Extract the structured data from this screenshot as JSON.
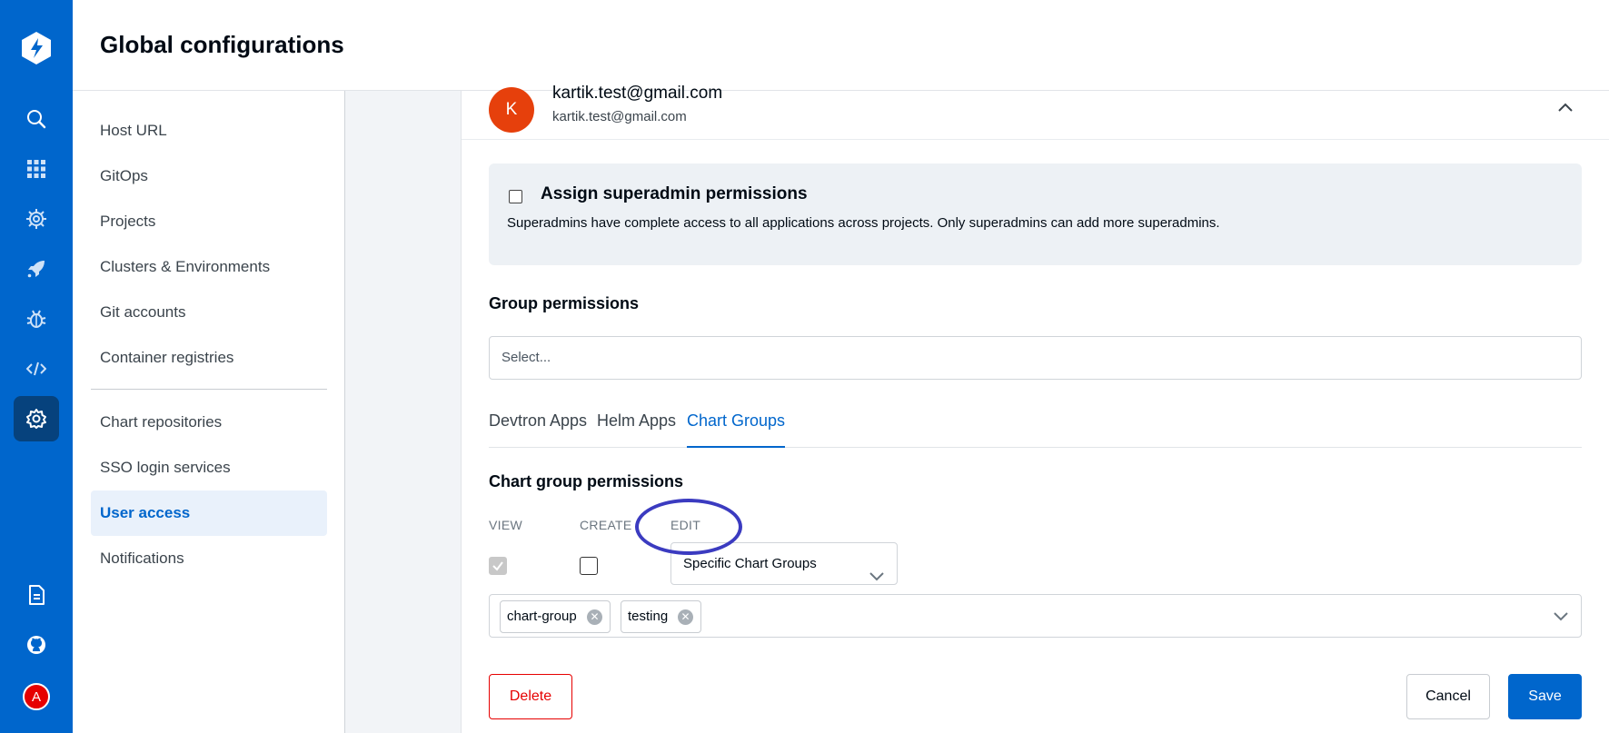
{
  "app": {
    "title": "Global configurations"
  },
  "rail": {
    "icons": [
      "devtron-logo-icon",
      "search-icon",
      "apps-grid-icon",
      "helm-chart-icon",
      "deploy-rocket-icon",
      "security-bug-icon",
      "code-icon",
      "settings-gear-icon",
      "docs-icon",
      "github-icon"
    ],
    "avatar_letter": "A",
    "colors": {
      "rail": "#0066cc",
      "active": "#06427d"
    }
  },
  "sidebar": {
    "items": [
      {
        "label": "Host URL"
      },
      {
        "label": "GitOps"
      },
      {
        "label": "Projects"
      },
      {
        "label": "Clusters & Environments"
      },
      {
        "label": "Git accounts"
      },
      {
        "label": "Container registries"
      },
      {
        "label": "Chart repositories"
      },
      {
        "label": "SSO login services"
      },
      {
        "label": "User access"
      },
      {
        "label": "Notifications"
      }
    ],
    "active": "User access"
  },
  "user": {
    "avatar_letter": "K",
    "name": "kartik.test@gmail.com",
    "email": "kartik.test@gmail.com"
  },
  "superadmin": {
    "title": "Assign superadmin permissions",
    "description": "Superadmins have complete access to all applications across projects. Only superadmins can add more superadmins.",
    "checked": false
  },
  "group_permissions": {
    "title": "Group permissions",
    "placeholder": "Select..."
  },
  "tabs": [
    {
      "label": "Devtron Apps"
    },
    {
      "label": "Helm Apps"
    },
    {
      "label": "Chart Groups"
    }
  ],
  "active_tab": "Chart Groups",
  "chart_group_permissions": {
    "title": "Chart group permissions",
    "columns": {
      "view": "VIEW",
      "create": "CREATE",
      "edit": "EDIT"
    },
    "view_checked": true,
    "create_checked": false,
    "edit_value": "Specific Chart Groups",
    "chips": [
      {
        "label": "chart-group"
      },
      {
        "label": "testing"
      }
    ]
  },
  "buttons": {
    "delete": "Delete",
    "cancel": "Cancel",
    "save": "Save"
  },
  "colors": {
    "accent": "#0066cc",
    "danger": "#e60000",
    "annotation": "#3b3bc0"
  }
}
